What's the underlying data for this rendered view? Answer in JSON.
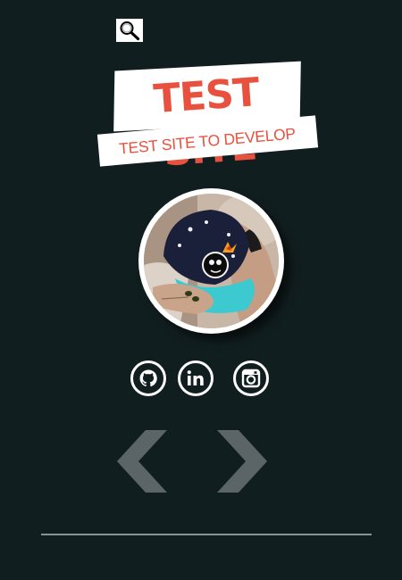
{
  "search": {
    "icon": "search-icon"
  },
  "logo": {
    "title": "TEST SITE",
    "subtitle": "TEST SITE TO DEVELOP"
  },
  "profile": {
    "avatar": "avatar"
  },
  "social": [
    {
      "name": "github",
      "icon": "github-icon"
    },
    {
      "name": "linkedin",
      "icon": "linkedin-icon"
    },
    {
      "name": "instagram",
      "icon": "instagram-icon"
    }
  ],
  "nav": {
    "prev_icon": "chevron-left-icon",
    "next_icon": "chevron-right-icon"
  },
  "colors": {
    "background": "#111e1f",
    "accent": "#e8513e",
    "white": "#ffffff",
    "arrow": "#5b6567",
    "divider": "#8a9294"
  }
}
